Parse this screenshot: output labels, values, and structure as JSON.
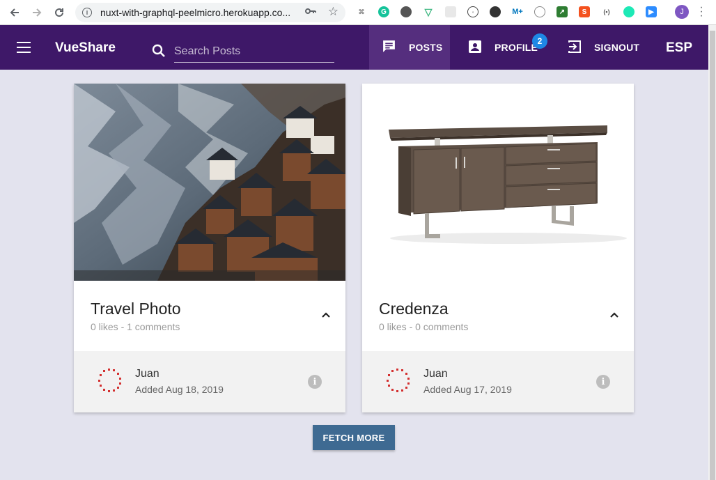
{
  "browser": {
    "url": "nuxt-with-graphql-peelmicro.herokuapp.co...",
    "profile_initial": "J",
    "icons": [
      "back-icon",
      "forward-icon",
      "reload-icon",
      "info-icon",
      "key-icon",
      "star-icon"
    ]
  },
  "appbar": {
    "title": "VueShare",
    "search_placeholder": "Search Posts",
    "nav": {
      "posts": "POSTS",
      "profile": "PROFILE",
      "profile_badge": "2",
      "signout": "SIGNOUT"
    },
    "language": "ESP",
    "color": "#3e1868"
  },
  "posts": [
    {
      "title": "Travel Photo",
      "stats": "0 likes - 1 comments",
      "author": "Juan",
      "added": "Added Aug 18, 2019"
    },
    {
      "title": "Credenza",
      "stats": "0 likes - 0 comments",
      "author": "Juan",
      "added": "Added Aug 17, 2019"
    }
  ],
  "fetch_more": "FETCH MORE",
  "colors": {
    "background": "#e3e3ee",
    "button": "#3e6a92",
    "badge": "#1e88e5"
  }
}
